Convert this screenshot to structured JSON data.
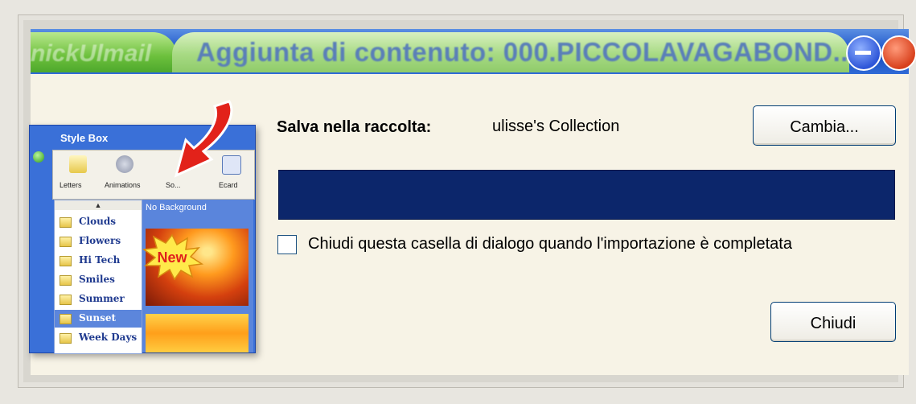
{
  "window": {
    "left_tab": "nickUlmail",
    "title": "Aggiunta di contenuto: 000.PICCOLAVAGABOND..."
  },
  "dialog": {
    "save_label": "Salva nella raccolta:",
    "collection": "ulisse's Collection",
    "change_button": "Cambia...",
    "progress": 1.0,
    "checkbox_label": "Chiudi questa casella di dialogo quando l'importazione è completata",
    "checkbox_checked": false,
    "close_button": "Chiudi"
  },
  "stylebox": {
    "title": "Style Box",
    "toolbar": [
      "Letters",
      "Animations",
      "So...",
      "Ecard"
    ],
    "scroll_up": "▲",
    "list": [
      "Clouds",
      "Flowers",
      "Hi Tech",
      "Smiles",
      "Summer",
      "Sunset",
      "Week Days"
    ],
    "selected": "Sunset",
    "no_background": "No Background",
    "badge": "New"
  },
  "colors": {
    "progress_fill": "#0c266b",
    "titlebar": "#2c63cf",
    "tab_green": "#a7da83"
  },
  "icons": [
    "minimize-icon",
    "close-icon",
    "arrow-icon",
    "folder-icon"
  ]
}
